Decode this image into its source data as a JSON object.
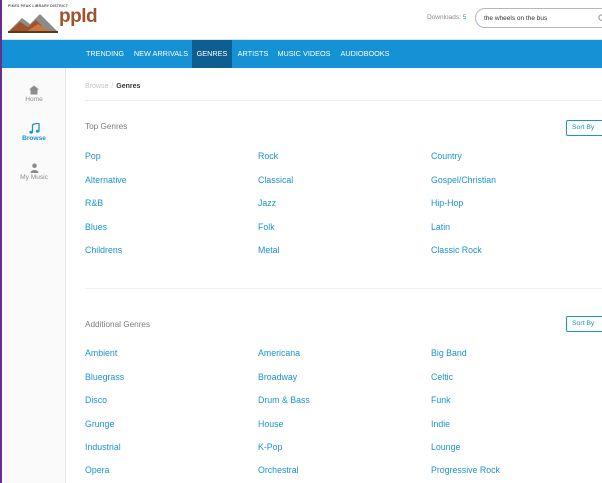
{
  "header": {
    "logo_small_text": "PIKES PEAK LIBRARY DISTRICT",
    "logo_text": "ppld",
    "downloads_label": "Downloads:",
    "downloads_count": "5",
    "search_value": "the wheels on the bus"
  },
  "nav": {
    "items": [
      "TRENDING",
      "NEW ARRIVALS",
      "GENRES",
      "ARTISTS",
      "MUSIC VIDEOS",
      "AUDIOBOOKS"
    ],
    "active": "GENRES"
  },
  "sidebar": {
    "items": [
      {
        "label": "Home",
        "icon": "home-icon"
      },
      {
        "label": "Browse",
        "icon": "music-note-icon"
      },
      {
        "label": "My Music",
        "icon": "user-icon"
      }
    ],
    "active": "Browse"
  },
  "breadcrumb": {
    "link": "Browse",
    "separator": "/",
    "current": "Genres"
  },
  "top_genres": {
    "title": "Top Genres",
    "sort_label": "Sort By",
    "rows": [
      [
        "Pop",
        "Rock",
        "Country"
      ],
      [
        "Alternative",
        "Classical",
        "Gospel/Christian"
      ],
      [
        "R&B",
        "Jazz",
        "Hip-Hop"
      ],
      [
        "Blues",
        "Folk",
        "Latin"
      ],
      [
        "Childrens",
        "Metal",
        "Classic Rock"
      ]
    ]
  },
  "additional_genres": {
    "title": "Additional Genres",
    "sort_label": "Sort By",
    "rows": [
      [
        "Ambient",
        "Americana",
        "Big Band"
      ],
      [
        "Bluegrass",
        "Broadway",
        "Celtic"
      ],
      [
        "Disco",
        "Drum & Bass",
        "Funk"
      ],
      [
        "Grunge",
        "House",
        "Indie"
      ],
      [
        "Industrial",
        "K-Pop",
        "Lounge"
      ],
      [
        "Opera",
        "Orchestral",
        "Progressive Rock"
      ]
    ]
  },
  "colors": {
    "accent": "#1591d6",
    "nav_active": "#0d5f92",
    "link": "#1a93d1",
    "frame": "#6a2d8f"
  }
}
